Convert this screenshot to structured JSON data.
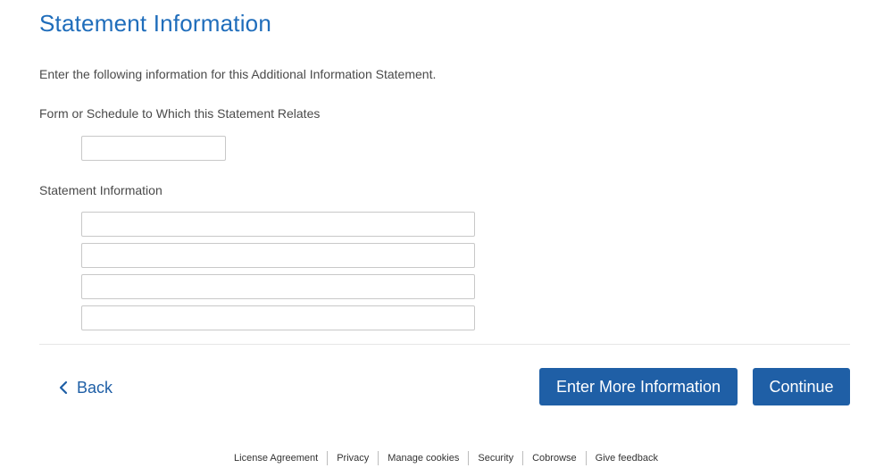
{
  "page": {
    "title": "Statement Information",
    "intro": "Enter the following information for this Additional Information Statement."
  },
  "form": {
    "form_schedule_label": "Form or Schedule to Which this Statement Relates",
    "form_schedule_value": "",
    "statement_label": "Statement Information",
    "statement_lines": [
      "",
      "",
      "",
      ""
    ]
  },
  "nav": {
    "back_label": "Back",
    "back_icon": "chevron-left-icon",
    "enter_more_label": "Enter More Information",
    "continue_label": "Continue"
  },
  "footer": {
    "links": [
      "License Agreement",
      "Privacy",
      "Manage cookies",
      "Security",
      "Cobrowse",
      "Give feedback"
    ]
  },
  "colors": {
    "title": "#1f6dbb",
    "primary_button": "#1f5fa6",
    "link": "#1f5fa6"
  }
}
